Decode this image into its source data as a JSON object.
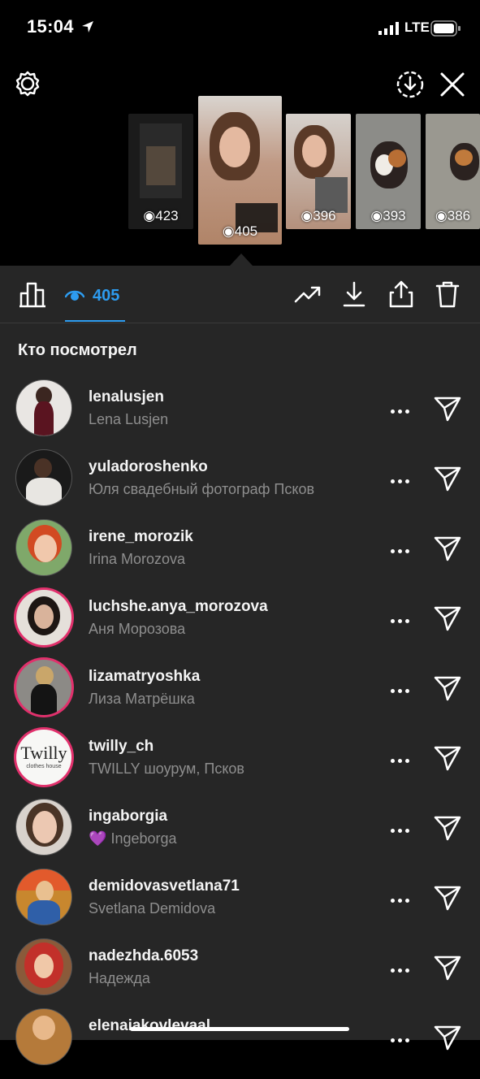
{
  "status_bar": {
    "time": "15:04",
    "network": "LTE"
  },
  "story_strip": {
    "thumbs": [
      {
        "views": "423"
      },
      {
        "views": "405"
      },
      {
        "views": "396"
      },
      {
        "views": "393"
      },
      {
        "views": "386"
      }
    ]
  },
  "toolbar": {
    "views_count": "405"
  },
  "section_title": "Кто посмотрел",
  "viewers": [
    {
      "username": "lenalusjen",
      "full_name": "Lena Lusjen"
    },
    {
      "username": "yuladoroshenko",
      "full_name": "Юля свадебный фотограф Псков"
    },
    {
      "username": "irene_morozik",
      "full_name": "Irina Morozova"
    },
    {
      "username": "luchshe.anya_morozova",
      "full_name": "Аня Морозова"
    },
    {
      "username": "lizamatryoshka",
      "full_name": "Лиза Матрёшка"
    },
    {
      "username": "twilly_ch",
      "full_name": "TWILLY шоурум, Псков"
    },
    {
      "username": "ingaborgia",
      "full_name": "Ingeborga",
      "emoji": "💜"
    },
    {
      "username": "demidovasvetlana71",
      "full_name": "Svetlana Demidova"
    },
    {
      "username": "nadezhda.6053",
      "full_name": "Надежда"
    },
    {
      "username": "elenaiakovlevaal",
      "full_name": ""
    }
  ],
  "avatar_texts": {
    "twilly_logo": "Twilly",
    "twilly_sub": "clothes house"
  },
  "colors": {
    "accent": "#2d9cf0",
    "story_ring": "#e1306c",
    "panel_bg": "#262626",
    "secondary_text": "#8e8e8e"
  },
  "icons": [
    "settings-icon",
    "download-circle-icon",
    "close-icon",
    "bar-chart-icon",
    "eye-icon",
    "trend-icon",
    "download-icon",
    "share-icon",
    "trash-icon",
    "more-icon",
    "send-icon"
  ]
}
